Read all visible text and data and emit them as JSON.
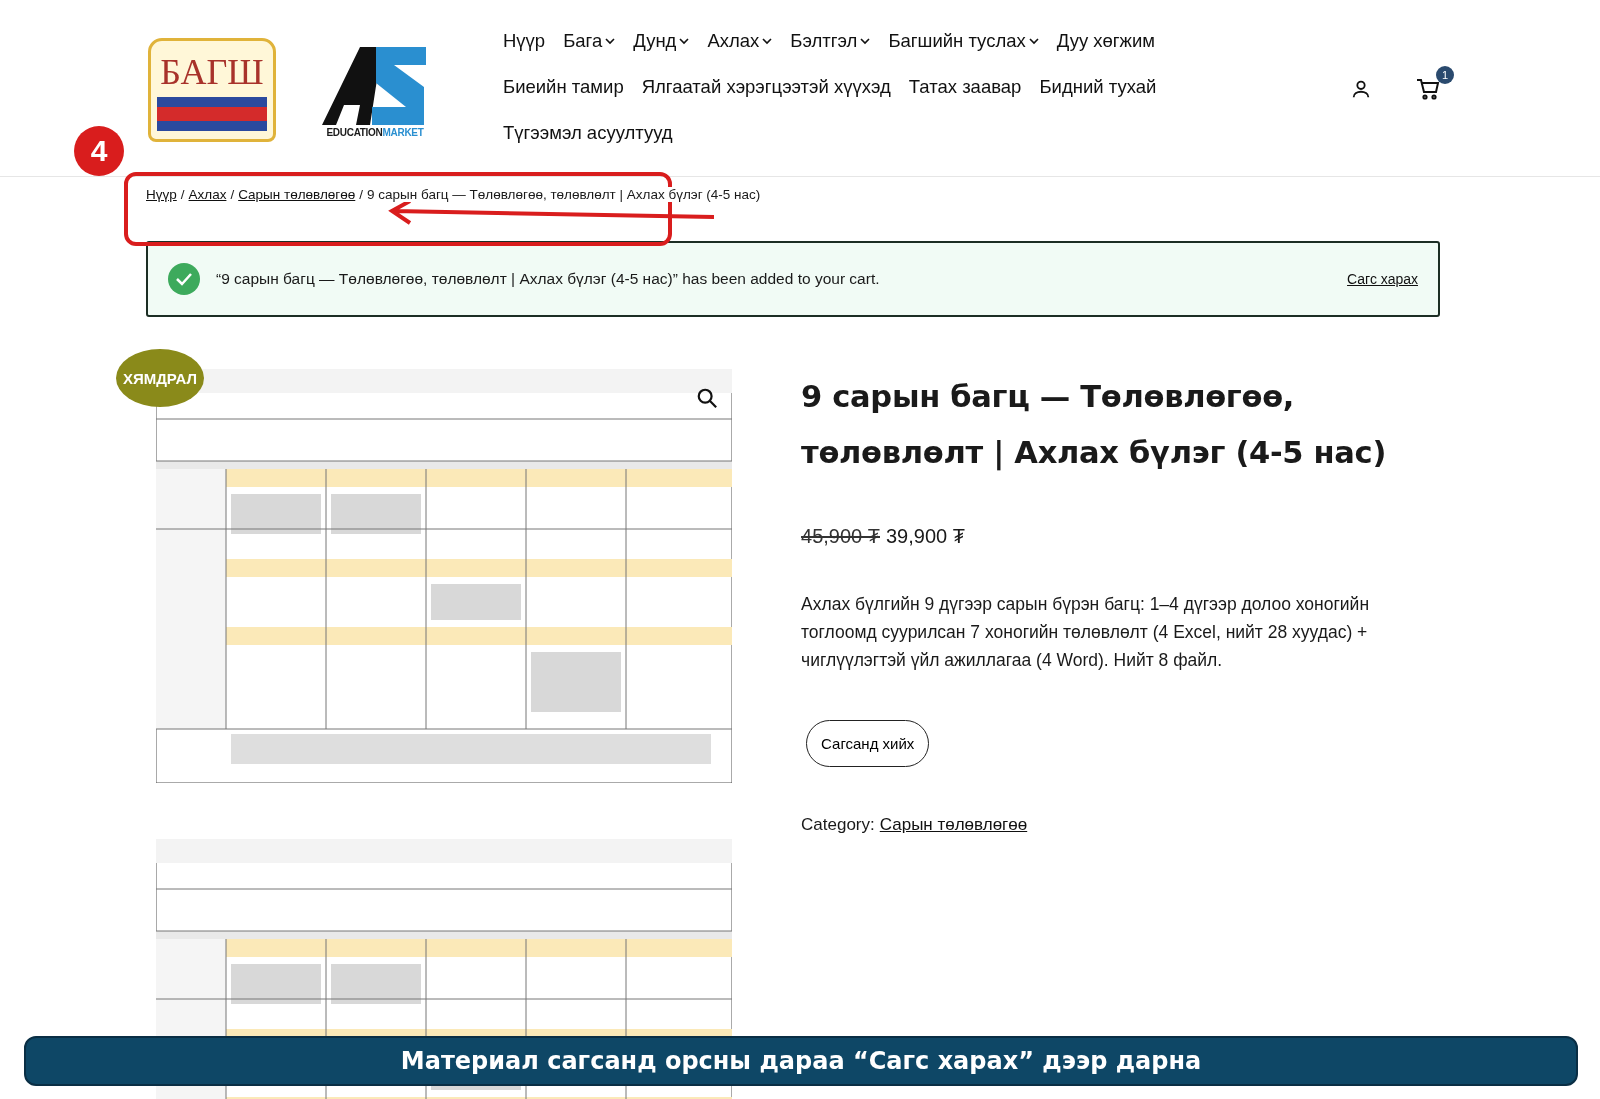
{
  "header": {
    "logos": [
      {
        "kind": "badge",
        "text": "БАГШ"
      },
      {
        "kind": "market",
        "text_a": "EDUCATION",
        "text_b": "MARKET"
      }
    ],
    "nav": [
      {
        "label": "Нүүр",
        "dropdown": false
      },
      {
        "label": "Бага",
        "dropdown": true
      },
      {
        "label": "Дунд",
        "dropdown": true
      },
      {
        "label": "Ахлах",
        "dropdown": true
      },
      {
        "label": "Бэлтгэл",
        "dropdown": true
      },
      {
        "label": "Багшийн туслах",
        "dropdown": true
      },
      {
        "label": "Дуу хөгжим",
        "dropdown": false
      },
      {
        "label": "Биеийн тамир",
        "dropdown": false
      },
      {
        "label": "Ялгаатай хэрэгцээтэй хүүхэд",
        "dropdown": false
      },
      {
        "label": "Татах заавар",
        "dropdown": false
      },
      {
        "label": "Бидний тухай",
        "dropdown": false
      },
      {
        "label": "Түгээмэл асуултууд",
        "dropdown": false
      }
    ],
    "cart_count": "1"
  },
  "breadcrumb": {
    "separator": "/",
    "links": [
      "Нүүр",
      "Ахлах",
      "Сарын төлөвлөгөө"
    ],
    "current": "9 сарын багц — Төлөвлөгөө, төлөвлөлт | Ахлах бүлэг (4-5 нас)"
  },
  "notice": {
    "message": "“9 сарын багц — Төлөвлөгөө, төлөвлөлт | Ахлах бүлэг (4-5 нас)” has been added to your cart.",
    "link": "Сагс харах"
  },
  "product": {
    "sale_badge": "ХЯМДРАЛ",
    "title": "9 сарын багц — Төлөвлөгөө, төлөвлөлт | Ахлах бүлэг (4-5 нас)",
    "old_price": "45,900 ₮",
    "price": "39,900 ₮",
    "description": "Ахлах бүлгийн 9 дүгээр сарын бүрэн багц: 1–4 дүгээр долоо хоногийн тоглоомд суурилсан 7 хоногийн төлөвлөлт (4 Excel, нийт 28 хуудас) + чиглүүлэгтэй үйл ажиллагаа (4 Word). Нийт 8 файл.",
    "button": "Сагсанд хийх",
    "category_label": "Category:",
    "category": "Сарын төлөвлөгөө"
  },
  "annotation": {
    "step": "4",
    "caption": "Материал сагсанд орсны дараа “Сагс харах” дээр дарна"
  }
}
